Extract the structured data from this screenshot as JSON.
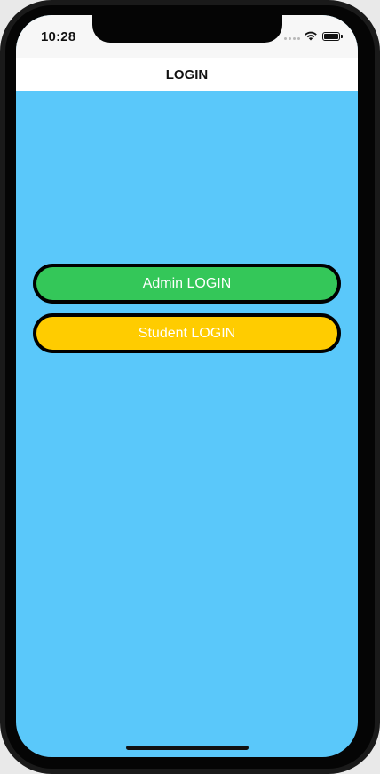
{
  "status_bar": {
    "time": "10:28",
    "icons": [
      "signal-icon",
      "wifi-icon",
      "battery-icon"
    ]
  },
  "nav": {
    "title": "LOGIN"
  },
  "buttons": {
    "admin_label": "Admin LOGIN",
    "student_label": "Student LOGIN"
  },
  "colors": {
    "background": "#5ac8fa",
    "admin_button": "#34c759",
    "student_button": "#ffcc00",
    "button_border": "#000000"
  }
}
